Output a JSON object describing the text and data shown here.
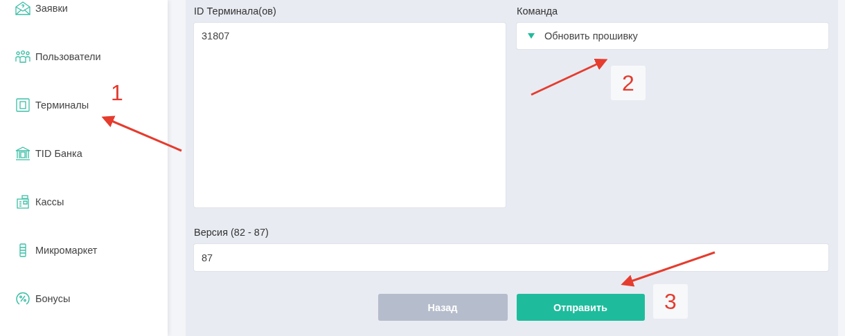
{
  "sidebar": {
    "items": [
      {
        "label": "Заявки"
      },
      {
        "label": "Пользователи"
      },
      {
        "label": "Терминалы"
      },
      {
        "label": "TID Банка"
      },
      {
        "label": "Кассы"
      },
      {
        "label": "Микромаркет"
      },
      {
        "label": "Бонусы"
      }
    ]
  },
  "form": {
    "terminal_ids": {
      "label": "ID Терминала(ов)",
      "value": "31807"
    },
    "command": {
      "label": "Команда",
      "value": "Обновить прошивку"
    },
    "version": {
      "label": "Версия (82 - 87)",
      "value": "87"
    },
    "buttons": [
      {
        "label": "Назад",
        "kind": "secondary"
      },
      {
        "label": "Отправить",
        "kind": "primary"
      }
    ]
  },
  "annotations": [
    {
      "label": "1",
      "boxed": false
    },
    {
      "label": "2",
      "boxed": true
    },
    {
      "label": "3",
      "boxed": true
    }
  ]
}
